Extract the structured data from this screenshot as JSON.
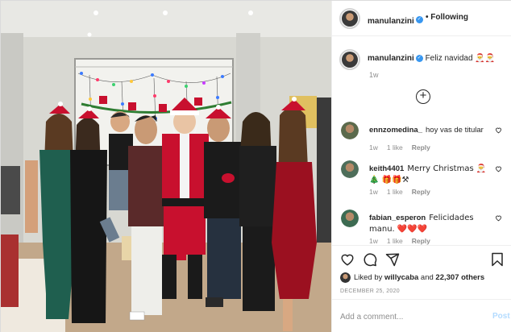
{
  "header": {
    "username": "manulanzini",
    "separator": "•",
    "follow_label": "Following"
  },
  "caption": {
    "username": "manulanzini",
    "text": "Feliz navidad 🎅🎅",
    "time": "1w"
  },
  "comments": [
    {
      "username": "ennzomedina_",
      "text": "hoy vas de titular",
      "time": "1w",
      "likes": "1 like",
      "reply": "Reply"
    },
    {
      "username": "keith4401",
      "text": "Merry Christmas 🎅 🎄 🎁🎁⚒",
      "time": "1w",
      "likes": "1 like",
      "reply": "Reply"
    },
    {
      "username": "fabian_esperon",
      "text": "Felicidades manu. ❤️❤️❤️",
      "time": "1w",
      "likes": "1 like",
      "reply": "Reply"
    }
  ],
  "likes": {
    "prefix": "Liked by",
    "user": "willycaba",
    "and": "and",
    "others": "22,307 others"
  },
  "date": "DECEMBER 25, 2020",
  "add_comment": {
    "placeholder": "Add a comment...",
    "post_label": "Post"
  },
  "colors": {
    "verified": "#3897f0",
    "post_disabled": "#b3dbff",
    "santa_red": "#c8102e",
    "heart": "#ed4956"
  },
  "icons": [
    "heart-icon",
    "comment-icon",
    "share-icon",
    "bookmark-icon",
    "verified-icon",
    "add-circle-icon"
  ]
}
